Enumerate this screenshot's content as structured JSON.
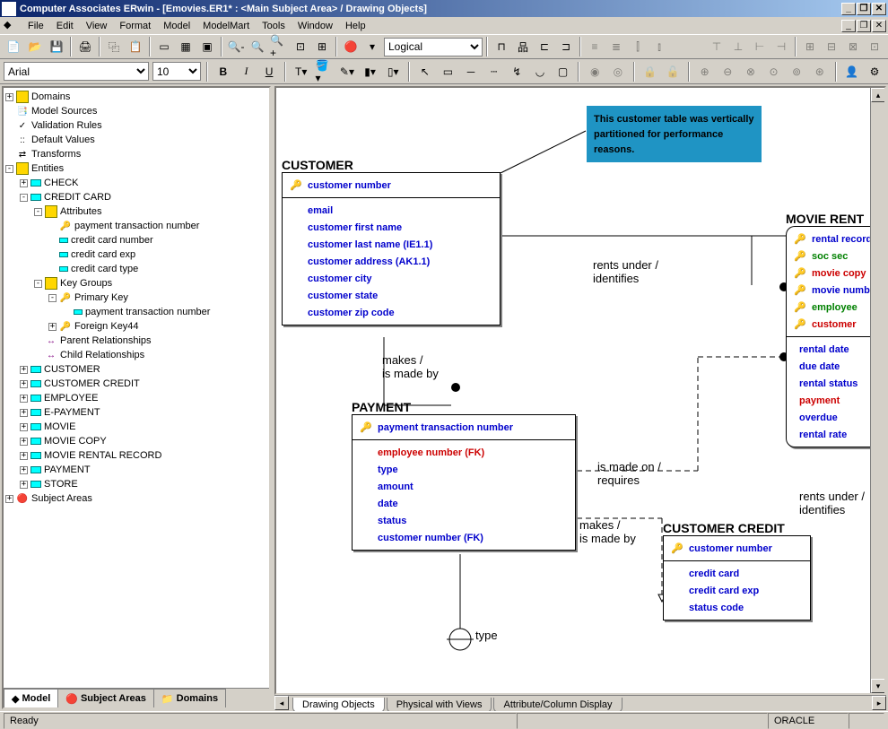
{
  "title": "Computer Associates ERwin - [Emovies.ER1* : <Main Subject Area> / Drawing Objects]",
  "menu": [
    "File",
    "Edit",
    "View",
    "Format",
    "Model",
    "ModelMart",
    "Tools",
    "Window",
    "Help"
  ],
  "toolbar": {
    "mode_select": "Logical"
  },
  "font": {
    "name": "Arial",
    "size": "10"
  },
  "tree": {
    "root": [
      {
        "exp": "+",
        "icon": "folder",
        "label": "Domains"
      },
      {
        "exp": " ",
        "icon": "ms",
        "label": "Model Sources"
      },
      {
        "exp": " ",
        "icon": "vr",
        "label": "Validation Rules"
      },
      {
        "exp": " ",
        "icon": "dv",
        "label": "Default Values"
      },
      {
        "exp": " ",
        "icon": "tr",
        "label": "Transforms"
      },
      {
        "exp": "-",
        "icon": "folder",
        "label": "Entities",
        "children": [
          {
            "exp": "+",
            "icon": "entity",
            "label": "CHECK"
          },
          {
            "exp": "-",
            "icon": "entity",
            "label": "CREDIT CARD",
            "children": [
              {
                "exp": "-",
                "icon": "folder",
                "label": "Attributes",
                "children": [
                  {
                    "exp": " ",
                    "icon": "key",
                    "label": "payment transaction number"
                  },
                  {
                    "exp": " ",
                    "icon": "attr",
                    "label": "credit card number"
                  },
                  {
                    "exp": " ",
                    "icon": "attr",
                    "label": "credit card exp"
                  },
                  {
                    "exp": " ",
                    "icon": "attr",
                    "label": "credit card type"
                  }
                ]
              },
              {
                "exp": "-",
                "icon": "folder",
                "label": "Key Groups",
                "children": [
                  {
                    "exp": "-",
                    "icon": "key",
                    "label": "Primary Key",
                    "children": [
                      {
                        "exp": " ",
                        "icon": "attr",
                        "label": "payment transaction number"
                      }
                    ]
                  },
                  {
                    "exp": "+",
                    "icon": "key",
                    "label": "Foreign Key44"
                  }
                ]
              },
              {
                "exp": " ",
                "icon": "rel",
                "label": "Parent Relationships"
              },
              {
                "exp": " ",
                "icon": "rel",
                "label": "Child Relationships"
              }
            ]
          },
          {
            "exp": "+",
            "icon": "entity",
            "label": "CUSTOMER"
          },
          {
            "exp": "+",
            "icon": "entity",
            "label": "CUSTOMER CREDIT"
          },
          {
            "exp": "+",
            "icon": "entity",
            "label": "EMPLOYEE"
          },
          {
            "exp": "+",
            "icon": "entity",
            "label": "E-PAYMENT"
          },
          {
            "exp": "+",
            "icon": "entity",
            "label": "MOVIE"
          },
          {
            "exp": "+",
            "icon": "entity",
            "label": "MOVIE COPY"
          },
          {
            "exp": "+",
            "icon": "entity",
            "label": "MOVIE RENTAL RECORD"
          },
          {
            "exp": "+",
            "icon": "entity",
            "label": "PAYMENT"
          },
          {
            "exp": "+",
            "icon": "entity",
            "label": "STORE"
          }
        ]
      },
      {
        "exp": "+",
        "icon": "sa",
        "label": "Subject Areas"
      }
    ]
  },
  "sidebar_tabs": [
    {
      "label": "Model",
      "active": true
    },
    {
      "label": "Subject Areas",
      "active": false
    },
    {
      "label": "Domains",
      "active": false
    }
  ],
  "entities": {
    "customer": {
      "title": "CUSTOMER",
      "pk": [
        "customer number"
      ],
      "attrs": [
        {
          "t": "email",
          "c": "blue"
        },
        {
          "t": "customer first name",
          "c": "blue"
        },
        {
          "t": "customer last name (IE1.1)",
          "c": "blue"
        },
        {
          "t": "customer address (AK1.1)",
          "c": "blue"
        },
        {
          "t": "customer city",
          "c": "blue"
        },
        {
          "t": "customer state",
          "c": "blue"
        },
        {
          "t": "customer zip code",
          "c": "blue"
        }
      ]
    },
    "payment": {
      "title": "PAYMENT",
      "pk": [
        "payment transaction number"
      ],
      "attrs": [
        {
          "t": "employee number (FK)",
          "c": "red"
        },
        {
          "t": "type",
          "c": "blue"
        },
        {
          "t": "amount",
          "c": "blue"
        },
        {
          "t": "date",
          "c": "blue"
        },
        {
          "t": "status",
          "c": "blue"
        },
        {
          "t": "customer number (FK)",
          "c": "blue"
        }
      ]
    },
    "customer_credit": {
      "title": "CUSTOMER CREDIT",
      "pk": [
        "customer number"
      ],
      "attrs": [
        {
          "t": "credit card",
          "c": "blue"
        },
        {
          "t": "credit card exp",
          "c": "blue"
        },
        {
          "t": "status code",
          "c": "blue"
        }
      ]
    },
    "movie_rental": {
      "title": "MOVIE RENTAL RECORD",
      "pk": [
        {
          "t": "rental record",
          "c": "blue"
        },
        {
          "t": "soc sec",
          "c": "green"
        },
        {
          "t": "movie copy",
          "c": "red"
        },
        {
          "t": "movie number",
          "c": "blue"
        },
        {
          "t": "employee",
          "c": "green"
        },
        {
          "t": "customer",
          "c": "red"
        }
      ],
      "attrs": [
        {
          "t": "rental date",
          "c": "blue"
        },
        {
          "t": "due date",
          "c": "blue"
        },
        {
          "t": "rental status",
          "c": "blue"
        },
        {
          "t": "payment",
          "c": "red"
        },
        {
          "t": "overdue",
          "c": "blue"
        },
        {
          "t": "rental rate",
          "c": "blue"
        }
      ]
    }
  },
  "note": "This customer table was vertically partitioned for performance reasons.",
  "rel_labels": {
    "rents_under": "rents under /\nidentifies",
    "makes1": "makes /\nis made by",
    "is_made_on": "is made on /\nrequires",
    "makes2": "makes /\nis made by",
    "rents_under2": "rents under /\nidentifies",
    "type": "type"
  },
  "canvas_tabs": [
    "Drawing Objects",
    "Physical with Views",
    "Attribute/Column Display"
  ],
  "status": {
    "msg": "Ready",
    "db": "ORACLE"
  }
}
